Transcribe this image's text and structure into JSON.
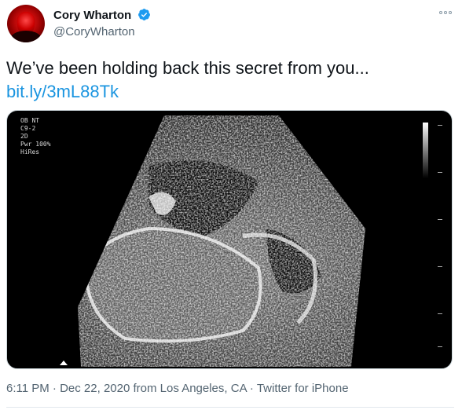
{
  "author": {
    "name": "Cory Wharton",
    "handle": "@CoryWharton",
    "verified": true,
    "avatar_icon": "avatar-red-portrait"
  },
  "tweet": {
    "text": "We’ve been holding back this secret from you...",
    "link": "bit.ly/3mL88Tk"
  },
  "media": {
    "type": "ultrasound-image",
    "overlay_lines": [
      "OB NT",
      "C9-2",
      "2D",
      "Pwr 100%",
      "HiRes"
    ]
  },
  "meta": {
    "time": "6:11 PM",
    "date": "Dec 22, 2020",
    "location": "from Los Angeles, CA",
    "source": "Twitter for iPhone",
    "separator": "·"
  },
  "colors": {
    "link": "#1b95e0",
    "verified": "#1d9bf0",
    "secondary_text": "#536471"
  },
  "icons": {
    "verified": "verified-badge-icon",
    "more": "more-options-icon"
  }
}
